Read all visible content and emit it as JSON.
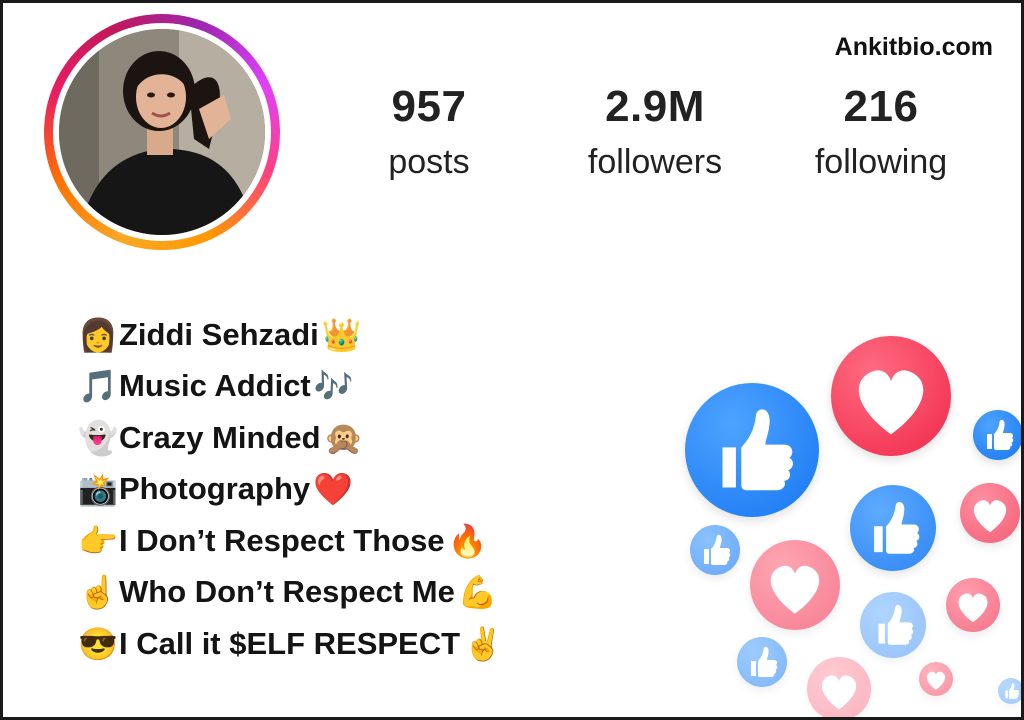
{
  "profile": {
    "watermark": "Ankitbio.com",
    "stats": [
      {
        "value": "957",
        "label": "posts"
      },
      {
        "value": "2.9M",
        "label": "followers"
      },
      {
        "value": "216",
        "label": "following"
      }
    ]
  },
  "bio": [
    {
      "lead": "👩",
      "text": "Ziddi Sehzadi",
      "trail": "👑"
    },
    {
      "lead": "🎵",
      "text": "Music Addict",
      "trail": "🎶"
    },
    {
      "lead": "👻",
      "text": "Crazy Minded",
      "trail": "🙊"
    },
    {
      "lead": "📸",
      "text": "Photography",
      "trail": "❤️"
    },
    {
      "lead": "👉",
      "text": "I Don’t Respect Those",
      "trail": "🔥"
    },
    {
      "lead": "☝️",
      "text": "Who Don’t Respect Me",
      "trail": "💪"
    },
    {
      "lead": "😎",
      "text": "I Call it $ELF RESPECT",
      "trail": "✌️"
    }
  ],
  "icons": {
    "like": "thumbs-up-icon",
    "love": "heart-icon"
  },
  "colors": {
    "like_blue": "#1877f2",
    "love_red": "#f0284a",
    "text": "#141414"
  }
}
